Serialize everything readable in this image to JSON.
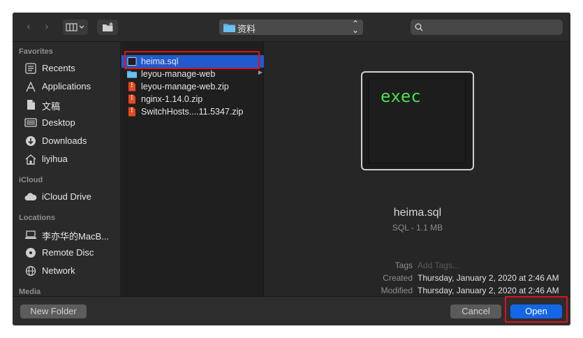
{
  "toolbar": {
    "back_icon": "chevron-left-icon",
    "forward_icon": "chevron-right-icon",
    "view_mode_icon": "column-view-icon",
    "new_folder_icon": "folder-plus-icon",
    "location": "资料",
    "search_placeholder": ""
  },
  "sidebar": {
    "favorites_title": "Favorites",
    "favorites": [
      {
        "label": "Recents",
        "icon": "clock-icon"
      },
      {
        "label": "Applications",
        "icon": "applications-icon"
      },
      {
        "label": "文稿",
        "icon": "documents-icon"
      },
      {
        "label": "Desktop",
        "icon": "desktop-icon"
      },
      {
        "label": "Downloads",
        "icon": "downloads-icon"
      },
      {
        "label": "liyihua",
        "icon": "home-icon"
      }
    ],
    "icloud_title": "iCloud",
    "icloud": [
      {
        "label": "iCloud Drive",
        "icon": "cloud-icon"
      }
    ],
    "locations_title": "Locations",
    "locations": [
      {
        "label": "李亦华的MacB...",
        "icon": "laptop-icon"
      },
      {
        "label": "Remote Disc",
        "icon": "disc-icon"
      },
      {
        "label": "Network",
        "icon": "network-icon"
      }
    ],
    "media_title": "Media"
  },
  "files": [
    {
      "name": "heima.sql",
      "icon": "sql-file-icon",
      "selected": true
    },
    {
      "name": "leyou-manage-web",
      "icon": "folder-icon",
      "selected": false
    },
    {
      "name": "leyou-manage-web.zip",
      "icon": "zip-file-icon",
      "selected": false
    },
    {
      "name": "nginx-1.14.0.zip",
      "icon": "zip-file-icon",
      "selected": false
    },
    {
      "name": "SwitchHosts....11.5347.zip",
      "icon": "zip-file-icon",
      "selected": false
    }
  ],
  "preview": {
    "thumbnail_text": "exec",
    "name": "heima.sql",
    "type_size": "SQL - 1.1 MB",
    "tags_label": "Tags",
    "tags_placeholder": "Add Tags...",
    "created_label": "Created",
    "created_value": "Thursday, January 2, 2020 at 2:46 AM",
    "modified_label": "Modified",
    "modified_value": "Thursday, January 2, 2020 at 2:46 AM"
  },
  "footer": {
    "new_folder": "New Folder",
    "cancel": "Cancel",
    "open": "Open"
  },
  "colors": {
    "accent": "#1466e6",
    "selection": "#1f5bce",
    "highlight_box": "#e0101a",
    "terminal_text": "#4be04a"
  }
}
